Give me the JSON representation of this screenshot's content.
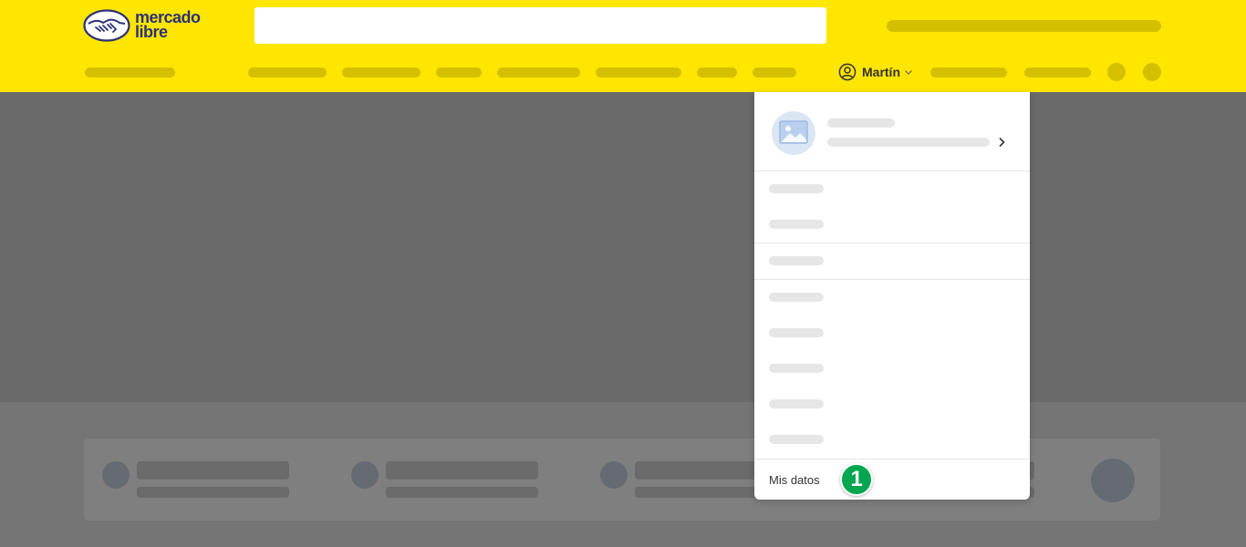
{
  "header": {
    "logo_line1": "mercado",
    "logo_line2": "libre",
    "search_value": "",
    "search_placeholder": ""
  },
  "user": {
    "name": "Martín"
  },
  "dropdown": {
    "mis_datos_label": "Mis datos"
  },
  "annotation": {
    "step": "1"
  },
  "colors": {
    "header_yellow": "#ffe600",
    "step_badge_green": "#00a650",
    "logo_blue": "#2d3277"
  },
  "icons": [
    "handshake-logo-icon",
    "user-icon",
    "chevron-down-icon",
    "image-placeholder-icon",
    "chevron-right-icon"
  ]
}
